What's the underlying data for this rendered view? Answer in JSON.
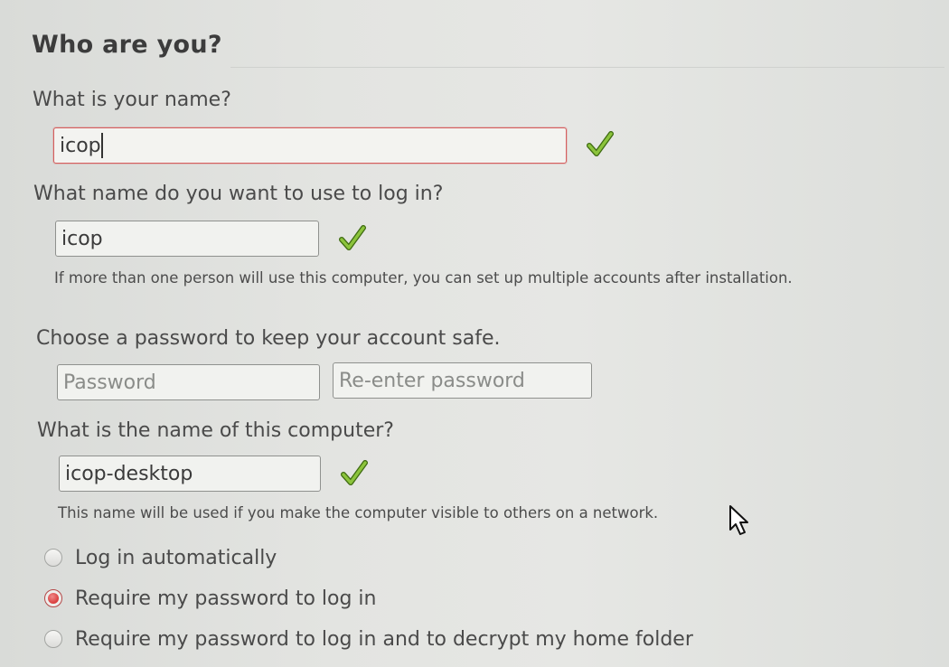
{
  "page": {
    "title": "Who are you?"
  },
  "name": {
    "label": "What is your name?",
    "value": "icop",
    "valid_icon": "checkmark-icon"
  },
  "login": {
    "label": "What name do you want to use to log in?",
    "value": "icop",
    "valid_icon": "checkmark-icon",
    "hint": "If more than one person will use this computer, you can set up multiple accounts after installation."
  },
  "password": {
    "label": "Choose a password to keep your account safe.",
    "placeholder": "Password",
    "confirm_placeholder": "Re-enter password"
  },
  "computer": {
    "label": "What is the name of this computer?",
    "value": "icop-desktop",
    "valid_icon": "checkmark-icon",
    "hint": "This name will be used if you make the computer visible to others on a network."
  },
  "login_options": [
    {
      "label": "Log in automatically",
      "selected": false
    },
    {
      "label": "Require my password to log in",
      "selected": true
    },
    {
      "label": "Require my password to log in and to decrypt my home folder",
      "selected": false
    }
  ],
  "colors": {
    "focus_border": "#d55f5f",
    "check_green": "#6aa124",
    "radio_selected": "#d93d3d"
  }
}
